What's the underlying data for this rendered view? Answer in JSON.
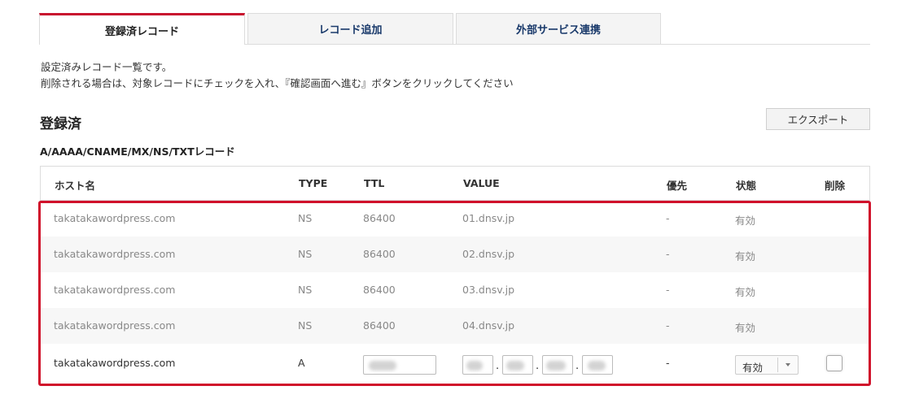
{
  "tabs": [
    {
      "label": "登録済レコード",
      "active": true
    },
    {
      "label": "レコード追加",
      "active": false
    },
    {
      "label": "外部サービス連携",
      "active": false
    }
  ],
  "intro": {
    "line1": "設定済みレコード一覧です。",
    "line2": "削除される場合は、対象レコードにチェックを入れ、『確認画面へ進む』ボタンをクリックしてください"
  },
  "section": {
    "title": "登録済",
    "export_label": "エクスポート",
    "subtitle": "A/AAAA/CNAME/MX/NS/TXTレコード"
  },
  "table": {
    "headers": {
      "host": "ホスト名",
      "type": "TYPE",
      "ttl": "TTL",
      "value": "VALUE",
      "priority": "優先",
      "status": "状態",
      "delete": "削除"
    },
    "rows": [
      {
        "host": "takatakawordpress.com",
        "type": "NS",
        "ttl": "86400",
        "value": "01.dnsv.jp",
        "priority": "-",
        "status": "有効"
      },
      {
        "host": "takatakawordpress.com",
        "type": "NS",
        "ttl": "86400",
        "value": "02.dnsv.jp",
        "priority": "-",
        "status": "有効"
      },
      {
        "host": "takatakawordpress.com",
        "type": "NS",
        "ttl": "86400",
        "value": "03.dnsv.jp",
        "priority": "-",
        "status": "有効"
      },
      {
        "host": "takatakawordpress.com",
        "type": "NS",
        "ttl": "86400",
        "value": "04.dnsv.jp",
        "priority": "-",
        "status": "有効"
      }
    ],
    "edit_row": {
      "host": "takatakawordpress.com",
      "type": "A",
      "priority": "-",
      "status_selected": "有効",
      "ip_separator": "."
    }
  },
  "colors": {
    "accent": "#c8102e",
    "highlight_border": "#d0112b",
    "tab_text": "#1a3a6b"
  }
}
